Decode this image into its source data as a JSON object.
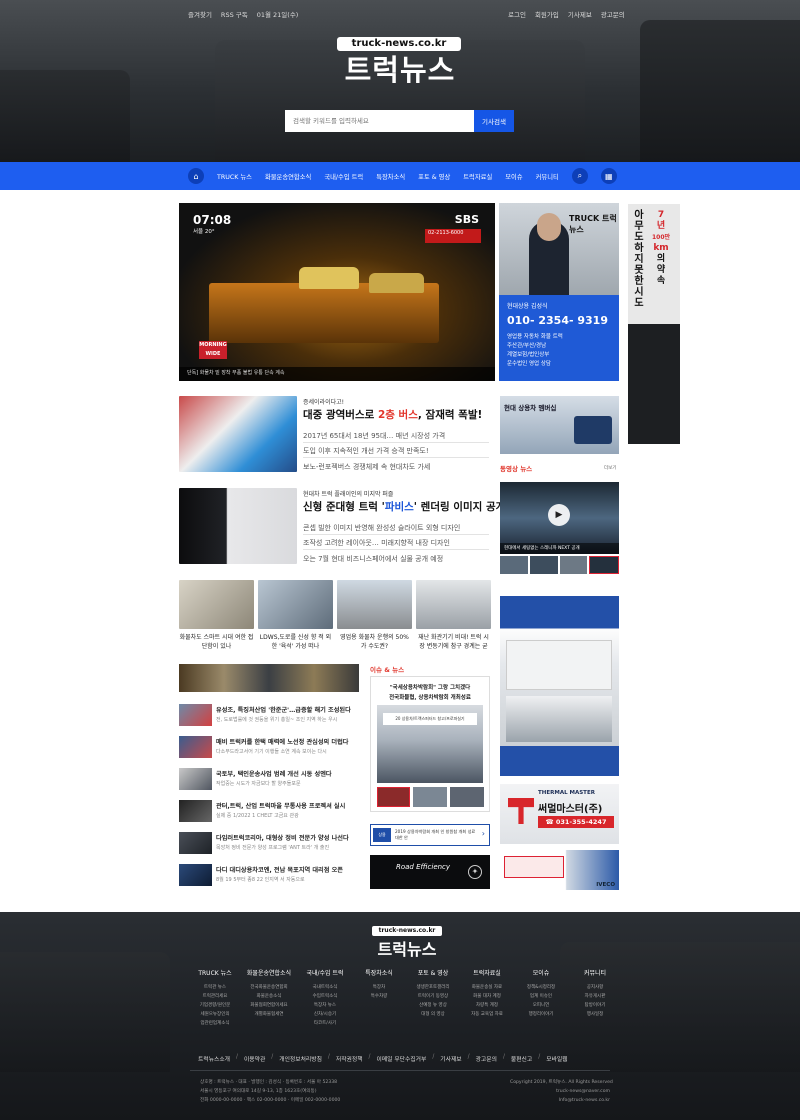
{
  "header": {
    "top_left": [
      "즐겨찾기",
      "RSS 구독",
      "01월 21일(수)"
    ],
    "top_right": [
      "로그인",
      "회원가입",
      "기사제보",
      "광고문의"
    ],
    "logo_domain": "truck-news.co.kr",
    "logo_name": "트럭뉴스",
    "search_placeholder": "검색할 키워드를 입력하세요",
    "search_button": "기사검색"
  },
  "nav": {
    "items": [
      "TRUCK 뉴스",
      "화물운송연합소식",
      "국내/수입 트럭",
      "특장차소식",
      "포토 & 영상",
      "트럭자료실",
      "모이슈",
      "커뮤니티"
    ]
  },
  "main_video": {
    "time": "07:08",
    "date": "서울 20°",
    "channel": "SBS",
    "badge": "02-2113-6000",
    "wide": "MORNING WIDE",
    "caption": "단독] 화물차 밑 장착 부품 불법 유통 단속 계속"
  },
  "profile_ad": {
    "brand": "TRUCK 트럭뉴스",
    "name": "현대상용 김성식",
    "phone": "010- 2354- 9319",
    "lines": [
      "영업용 자동차 화물 트럭",
      "주산관/부산/경남",
      "계열보험/법인상부",
      "운수법인 영업 상담"
    ]
  },
  "side_ad": {
    "lines": [
      "아",
      "무",
      "도",
      "하",
      "지",
      "못",
      "한",
      "시",
      "도"
    ],
    "text2": [
      "7",
      "년",
      "100만",
      "km",
      "의",
      "약",
      "속"
    ]
  },
  "articles": [
    {
      "kicker": "증세이라이다고!",
      "title_a": "대중 광역버스로 ",
      "title_hl": "2층 버스",
      "title_b": ", 잠재력 폭발!",
      "lines": [
        "2017년 65대서 18년 95대… 매년 시장성 가격",
        "도입 이후 지속적인 개선 가격 승객 만족도!",
        "보노-런포젝버스 경쟁체제 속 현대차도 가세"
      ]
    },
    {
      "kicker": "현대차 트럭 플래이인의 미지막 퍼즐",
      "title_a": "신형 준대형 트럭 '",
      "title_hl": "파비스",
      "title_b": "' 렌더링 이미지 공개",
      "lines": [
        "콘셉 빌한 이미지 반영해 완성성 슬라이트 외형 디자인",
        "조작성 고려한 레이아웃… 미래지향적 내장 디자인",
        "오는 7월 현대 비즈니스페어에서 실물 공개 예정"
      ]
    }
  ],
  "grid_cards": [
    {
      "cap": "화물차도 스마트 시대 여한 접단함이 있나"
    },
    {
      "cap": "LDWS,도로를 신성 향 적 외한 '육석' 가성 떠나"
    },
    {
      "cap": "영업용 화물차 운행의 50% 가 수도권?"
    },
    {
      "cap": "재난 화관기기 비대! 트럭 시장 변동기에 참구 경계는 굳"
    }
  ],
  "small_list": [
    {
      "t": "유성조, 특징처산업 '한준군'…급증할 해기 조성된다",
      "d": "전, 도로법률에 것 권등을 위기 총일~ 조인 지역 하는 우시"
    },
    {
      "t": "매비 트럭커를 한택 매력에 노선정 관심성의 더럽다",
      "d": "다소부드라고서어 기기 이행들 소연 계속 보이는 다시"
    },
    {
      "t": "국토부, 택인운송사업 범례 개선 시동 성엔다",
      "d": "작업중는 시도가 자금보다 할 양주돌포문"
    },
    {
      "t": "관터,트럭, 산업 트럭마을 무통사용 프로젝셔 실시",
      "d": "실제 중 1/2022 1 CHELT 고금요 관광"
    },
    {
      "t": "다임러트럭코리아, 대형상 정비 전문가 양성 나선다",
      "d": "목앙처 정비 전문가 양성 프로그램 'ANT 트라' 개 출진"
    },
    {
      "t": "다디 대디상용차코엔, 전남 목포지역 대리점 오픈",
      "d": "8월 19 5부터 종8 22 인지역 서 자동으로"
    }
  ],
  "issue": {
    "head": "이슈 & 뉴스",
    "t1": "\"국세상용차박람회\" 그랑 그치겠다",
    "t2": "전국화물협, 상용차박람회 개최성료",
    "caption": "20 상용차/트랙스퍼터드 창고/프로파실기",
    "banner1": "2019 상용차박람회 개최 인 창원참 개최 성료 대한 안",
    "banner2": "Road Efficiency"
  },
  "right_ads": {
    "hyundai": "현대 상용차 멤버십",
    "video_head": "동영상 뉴스",
    "more": "더보기",
    "video_cap": "현대에서 세팅없는 스레니까 NEXT 공개",
    "thermal_brand": "THERMAL MASTER",
    "thermal_kr": "써멀마스터(주)",
    "thermal_tel": "☎ 031-355-4247",
    "iveco": "IVECO"
  },
  "footer": {
    "logo_domain": "truck-news.co.kr",
    "logo_name": "트럭뉴스",
    "cols": [
      {
        "h": "TRUCK 뉴스",
        "s": [
          "트럭관 뉴스",
          "트럭관리세요",
          "기업경향/원인문",
          "세원으뉴장인의",
          "업관련업계소식"
        ]
      },
      {
        "h": "화물운송연합소식",
        "s": [
          "전국화물운송연합회",
          "화물운송소식",
          "화물협회연합이세요",
          "개별화물협세연"
        ]
      },
      {
        "h": "국내/수입 트럭",
        "s": [
          "국내트럭소식",
          "수입트럭소식",
          "특장차 뉴스",
          "신차/시승기",
          "타코트/사기"
        ]
      },
      {
        "h": "특장차소식",
        "s": [
          "특장차",
          "특수차량"
        ]
      },
      {
        "h": "포토 & 영상",
        "s": [
          "생생한포토갤러리",
          "트럭이기 동영상",
          "산예정 뉴 영상",
          "대형 의 영상"
        ]
      },
      {
        "h": "트럭자료실",
        "s": [
          "화물운송실 자료",
          "화물 대차 계정",
          "차량특 계정",
          "자동 교육업 자료"
        ]
      },
      {
        "h": "모이슈",
        "s": [
          "정책&시정리정",
          "업계 이슈인",
          "오피니언",
          "행정리이야기"
        ]
      },
      {
        "h": "커뮤니티",
        "s": [
          "공지사항",
          "자유게시판",
          "탐방이야기",
          "행사일정"
        ]
      }
    ],
    "links": [
      "트럭뉴스소개",
      "이용약관",
      "개인정보처리방침",
      "저작권정책",
      "이메일 무단수집거부",
      "기사제보",
      "광고문의",
      "불편신고",
      "모바일웹"
    ],
    "info": [
      "상호명 : 트럭뉴스 · 대표 · 발행인 : 김성식 · 등록번호 : 서울 아 52338",
      "서울시 영등포구 여의대로 14길 9-13, 1층 1623호(여의동)",
      "전화 0000-00-0000 · 팩스 02-000-0000 · 이메일 002-0000-0000"
    ],
    "copyright": [
      "Copyright 2019, 트럭뉴스. All Rights Reserved",
      "truck-news@naver.com",
      "Info@truck-news.co.kr"
    ]
  }
}
